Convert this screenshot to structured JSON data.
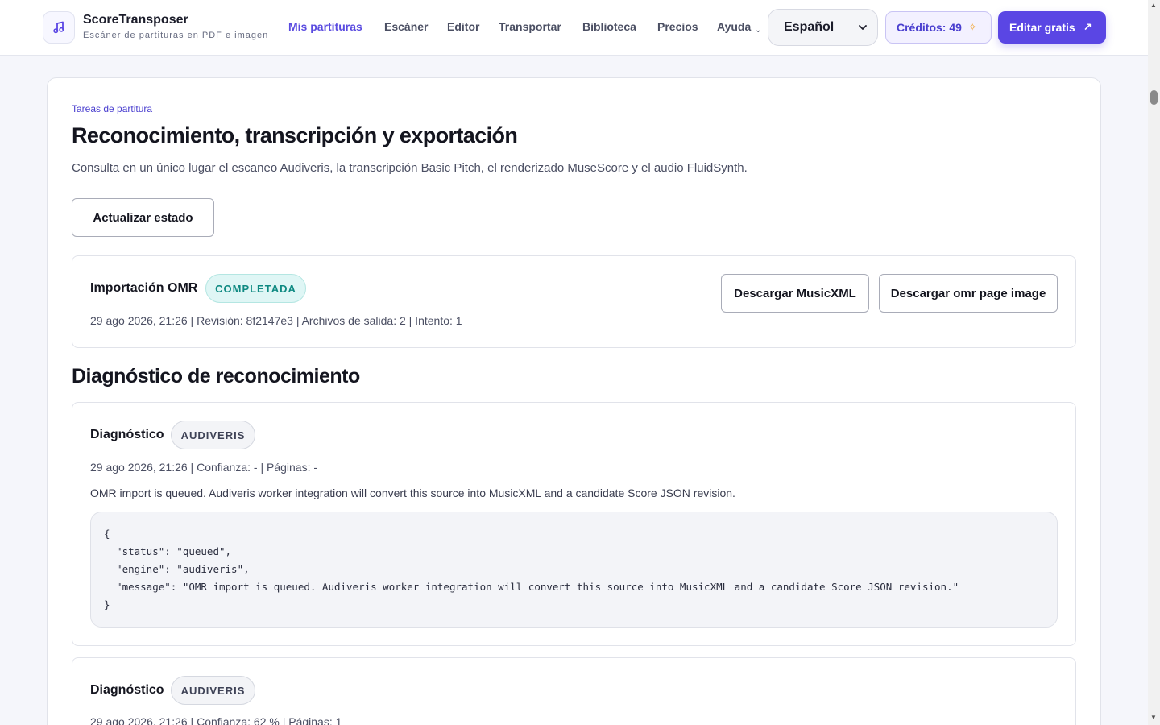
{
  "header": {
    "brand_name": "ScoreTransposer",
    "brand_tagline": "Escáner de partituras en PDF e imagen",
    "logo_icon": "music-note-icon",
    "nav": [
      {
        "label": "Mis partituras",
        "active": true
      },
      {
        "label": "Escáner",
        "active": false
      },
      {
        "label": "Editor",
        "active": false
      },
      {
        "label": "Transportar",
        "active": false
      },
      {
        "label": "Biblioteca",
        "active": false
      },
      {
        "label": "Precios",
        "active": false
      },
      {
        "label": "Ayuda",
        "active": false
      }
    ],
    "language": {
      "selected": "Español"
    },
    "credits_label": "Créditos: 49",
    "cta_label": "Editar gratis"
  },
  "page": {
    "eyebrow": "Tareas de partitura",
    "title": "Reconocimiento, transcripción y exportación",
    "subtitle": "Consulta en un único lugar el escaneo Audiveris, la transcripción Basic Pitch, el renderizado MuseScore y el audio FluidSynth.",
    "refresh_label": "Actualizar estado"
  },
  "omr_import": {
    "title": "Importación OMR",
    "status": "COMPLETADA",
    "meta": "29 ago 2026, 21:26 | Revisión: 8f2147e3 | Archivos de salida: 2 | Intento: 1",
    "download_musicxml": "Descargar MusicXML",
    "download_image": "Descargar omr page image"
  },
  "diagnostics_section": {
    "title": "Diagnóstico de reconocimiento",
    "items": [
      {
        "title": "Diagnóstico",
        "engine": "AUDIVERIS",
        "meta": "29 ago 2026, 21:26 | Confianza: - | Páginas: -",
        "message": "OMR import is queued. Audiveris worker integration will convert this source into MusicXML and a candidate Score JSON revision.",
        "code": "{\n  \"status\": \"queued\",\n  \"engine\": \"audiveris\",\n  \"message\": \"OMR import is queued. Audiveris worker integration will convert this source into MusicXML and a candidate Score JSON revision.\"\n}"
      },
      {
        "title": "Diagnóstico",
        "engine": "AUDIVERIS",
        "meta": "29 ago 2026, 21:26 | Confianza: 62 % | Páginas: 1"
      }
    ]
  },
  "colors": {
    "accent": "#5a46e4",
    "success": "#0f8a82",
    "spark": "#f2a93b"
  }
}
